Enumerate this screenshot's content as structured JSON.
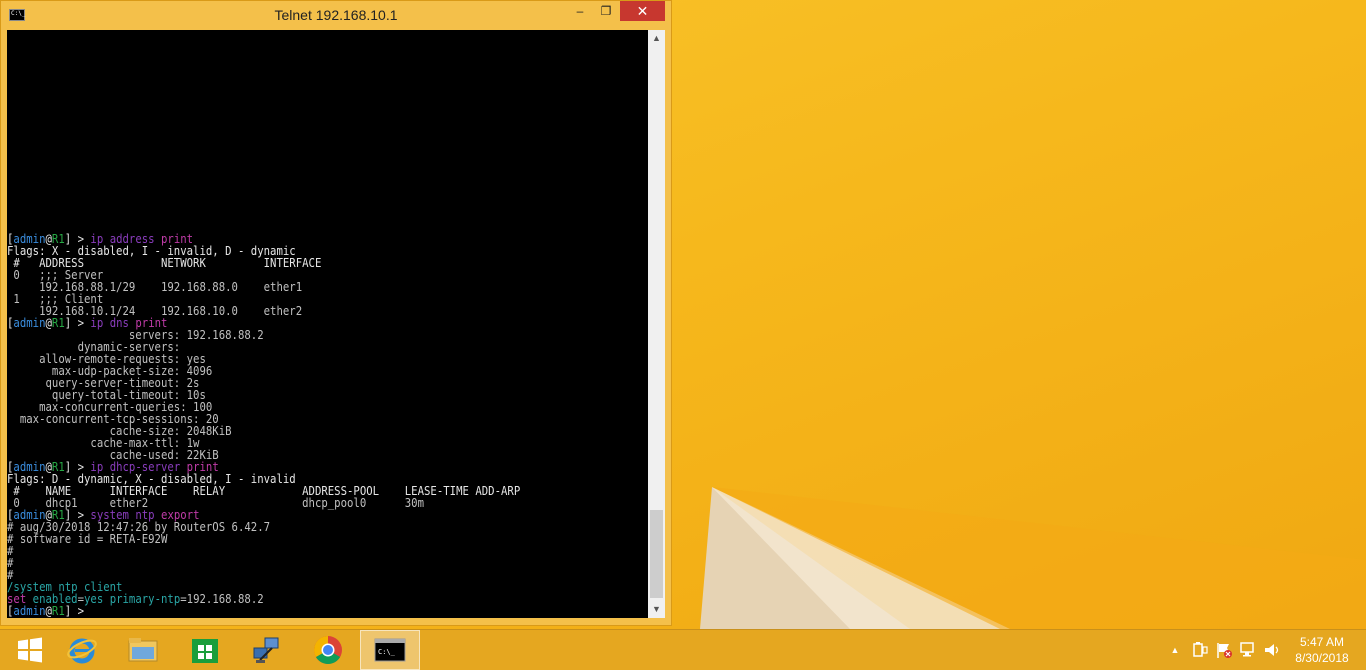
{
  "window": {
    "title": "Telnet 192.168.10.1",
    "icon_label": "C:\\_",
    "minimize_glyph": "–",
    "maximize_glyph": "❐",
    "close_glyph": "✕"
  },
  "terminal": {
    "prompt": {
      "open": "[",
      "user": "admin",
      "at": "@",
      "host": "R1",
      "close": "] > "
    },
    "cmd1": {
      "a": "ip",
      "b": "address",
      "c": "print"
    },
    "l_flags1": "Flags: X - disabled, I - invalid, D - dynamic",
    "l_addr_header": " #   ADDRESS            NETWORK         INTERFACE",
    "l_addr_0": " 0   ;;; Server",
    "l_addr_0b": "     192.168.88.1/29    192.168.88.0    ether1",
    "l_addr_1": " 1   ;;; Client",
    "l_addr_1b": "     192.168.10.1/24    192.168.10.0    ether2",
    "cmd2": {
      "a": "ip",
      "b": "dns",
      "c": "print"
    },
    "dns": [
      "                   servers: 192.168.88.2",
      "           dynamic-servers:",
      "     allow-remote-requests: yes",
      "       max-udp-packet-size: 4096",
      "      query-server-timeout: 2s",
      "       query-total-timeout: 10s",
      "     max-concurrent-queries: 100",
      "  max-concurrent-tcp-sessions: 20",
      "                cache-size: 2048KiB",
      "             cache-max-ttl: 1w",
      "                cache-used: 22KiB"
    ],
    "cmd3": {
      "a": "ip",
      "b": "dhcp-server",
      "c": "print"
    },
    "l_flags2": "Flags: D - dynamic, X - disabled, I - invalid",
    "l_dhcp_header": " #    NAME      INTERFACE    RELAY            ADDRESS-POOL    LEASE-TIME ADD-ARP",
    "l_dhcp_0": " 0    dhcp1     ether2                        dhcp_pool0      30m",
    "cmd4": {
      "a": "system",
      "b": "ntp",
      "c": "export"
    },
    "l_exp1": "# aug/30/2018 12:47:26 by RouterOS 6.42.7",
    "l_exp2": "# software id = RETA-E92W",
    "l_exp3": "#",
    "l_exp4": "#",
    "l_exp5": "#",
    "l_path": "/system ntp client",
    "set": {
      "kw": "set",
      "k1": "enabled",
      "eq1": "=",
      "v1": "yes",
      "k2": "primary-ntp",
      "eq2": "=",
      "v2": "192.168.88.2"
    }
  },
  "scrollbar": {
    "up": "▲",
    "down": "▼"
  },
  "taskbar": {
    "clock_time": "5:47 AM",
    "clock_date": "8/30/2018",
    "tray_arrow": "▲"
  },
  "colors": {
    "desktop": "#f6b81c",
    "taskbar": "#e5a720",
    "close_button": "#c7372f",
    "terminal_bg": "#000000",
    "prompt_user": "#3a8dde",
    "prompt_host": "#27a845",
    "command": "#8a3dbd"
  }
}
